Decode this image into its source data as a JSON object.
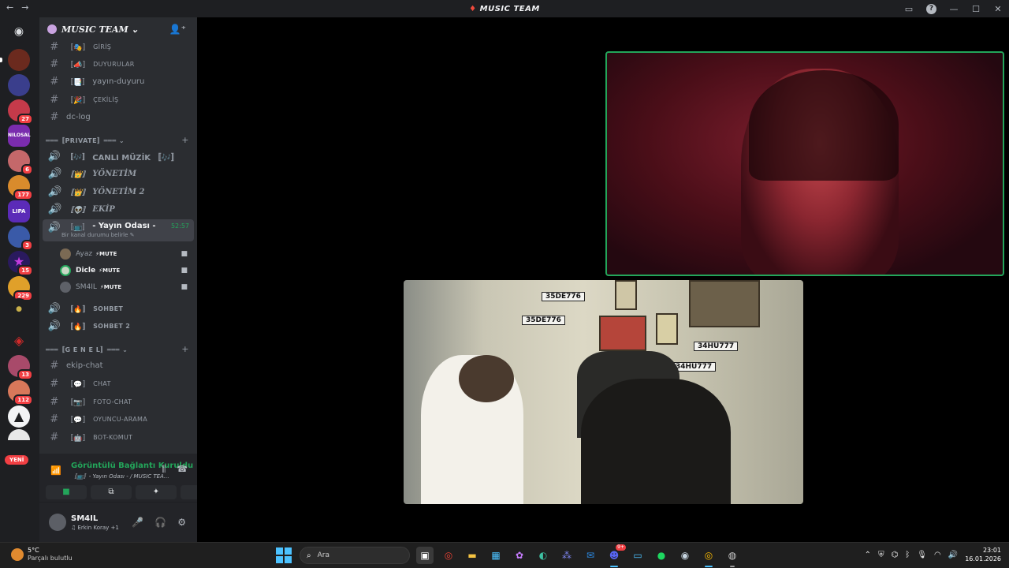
{
  "window": {
    "title": "MUSIC TEAM",
    "back": "←",
    "forward": "→",
    "help": "?",
    "minimize": "—",
    "maximize": "☐",
    "close": "✕"
  },
  "guild_badges": {
    "g3": "27",
    "g6": "6",
    "g7": "177",
    "g9": "3",
    "g10": "15",
    "g11": "229",
    "g14": "13",
    "g15": "112",
    "new": "YENİ"
  },
  "guild_labels": {
    "nilosal": "NILOSAL",
    "lipa": "LIPA"
  },
  "server": {
    "name": "MUSIC TEAM ⌄"
  },
  "channels": [
    {
      "sym": "#",
      "emo": "〚🎭〛",
      "label": "GİRİŞ"
    },
    {
      "sym": "#",
      "emo": "〚📣〛",
      "label": "DUYURULAR"
    },
    {
      "sym": "#",
      "emo": "〚📑〛",
      "label": "yayın-duyuru"
    },
    {
      "sym": "#",
      "emo": "〚🎉〛",
      "label": "ÇEKİLİŞ"
    },
    {
      "sym": "#",
      "emo": "",
      "label": "dc-log"
    }
  ],
  "categories": {
    "private": "═══〚PRIVATE〛═══ ⌄",
    "genel": "═══〚G E N E L〛═══ ⌄",
    "plus": "+"
  },
  "voice_channels": [
    {
      "sym": "🔊",
      "emo": "〚🎶〛",
      "label": "CANLI MÜZİK 〚🎶〛"
    },
    {
      "sym": "🔊",
      "emo": "〚👑〛",
      "label": "YÖNETİM"
    },
    {
      "sym": "🔊",
      "emo": "〚👑〛",
      "label": "YÖNETİM 2"
    },
    {
      "sym": "🔊",
      "emo": "〚👽〛",
      "label": "EKİP"
    }
  ],
  "active_channel": {
    "sym": "🔊",
    "emo": "〚📺〛",
    "label": "- Yayın Odası -",
    "timer": "52:57",
    "status": "Bir kanal durumu belirle ✎"
  },
  "voice_users": [
    {
      "name": "Ayaz",
      "mute": "⚡MUTE",
      "cam": "■"
    },
    {
      "name": "Dicle",
      "mute": "⚡MUTE",
      "cam": "■"
    },
    {
      "name": "SM4IL",
      "mute": "⚡MUTE",
      "cam": "■"
    }
  ],
  "voice_channels_2": [
    {
      "sym": "🔊",
      "emo": "〚🔥〛",
      "label": "SOHBET"
    },
    {
      "sym": "🔊",
      "emo": "〚🔥〛",
      "label": "SOHBET 2"
    }
  ],
  "channels_2": [
    {
      "sym": "#",
      "emo": "",
      "label": "ekip-chat"
    },
    {
      "sym": "#",
      "emo": "〚💬〛",
      "label": "CHAT"
    },
    {
      "sym": "#",
      "emo": "〚📷〛",
      "label": "FOTO-CHAT"
    },
    {
      "sym": "#",
      "emo": "〚💬〛",
      "label": "OYUNCU-ARAMA"
    },
    {
      "sym": "#",
      "emo": "〚🤖〛",
      "label": "BOT-KOMUT"
    }
  ],
  "voice_panel": {
    "status": "Görüntülü Bağlantı Kuruldu",
    "sub": "〚📺〛- Yayın Odası - / MUSIC TEA...",
    "signal": "📶",
    "soundboard_icon": "⫼",
    "disconnect_icon": "☎",
    "btn_camera": "■",
    "btn_screen": "⧉",
    "btn_activity": "✦",
    "btn_sound": "♫"
  },
  "user": {
    "name": "SM4IL",
    "sub": "♫ Erkin Koray +1",
    "mic": "🎤",
    "headset": "🎧",
    "settings": "⚙"
  },
  "video": {
    "plate1": "35DE776",
    "plate2": "35DE776",
    "plate3": "34HU777",
    "plate4": "34HU777"
  },
  "taskbar": {
    "temp": "5°C",
    "weather": "Parçalı bulutlu",
    "search_placeholder": "Ara",
    "discord_badge": "9+",
    "time": "23:01",
    "date": "16.01.2026",
    "tray_up": "⌃"
  }
}
